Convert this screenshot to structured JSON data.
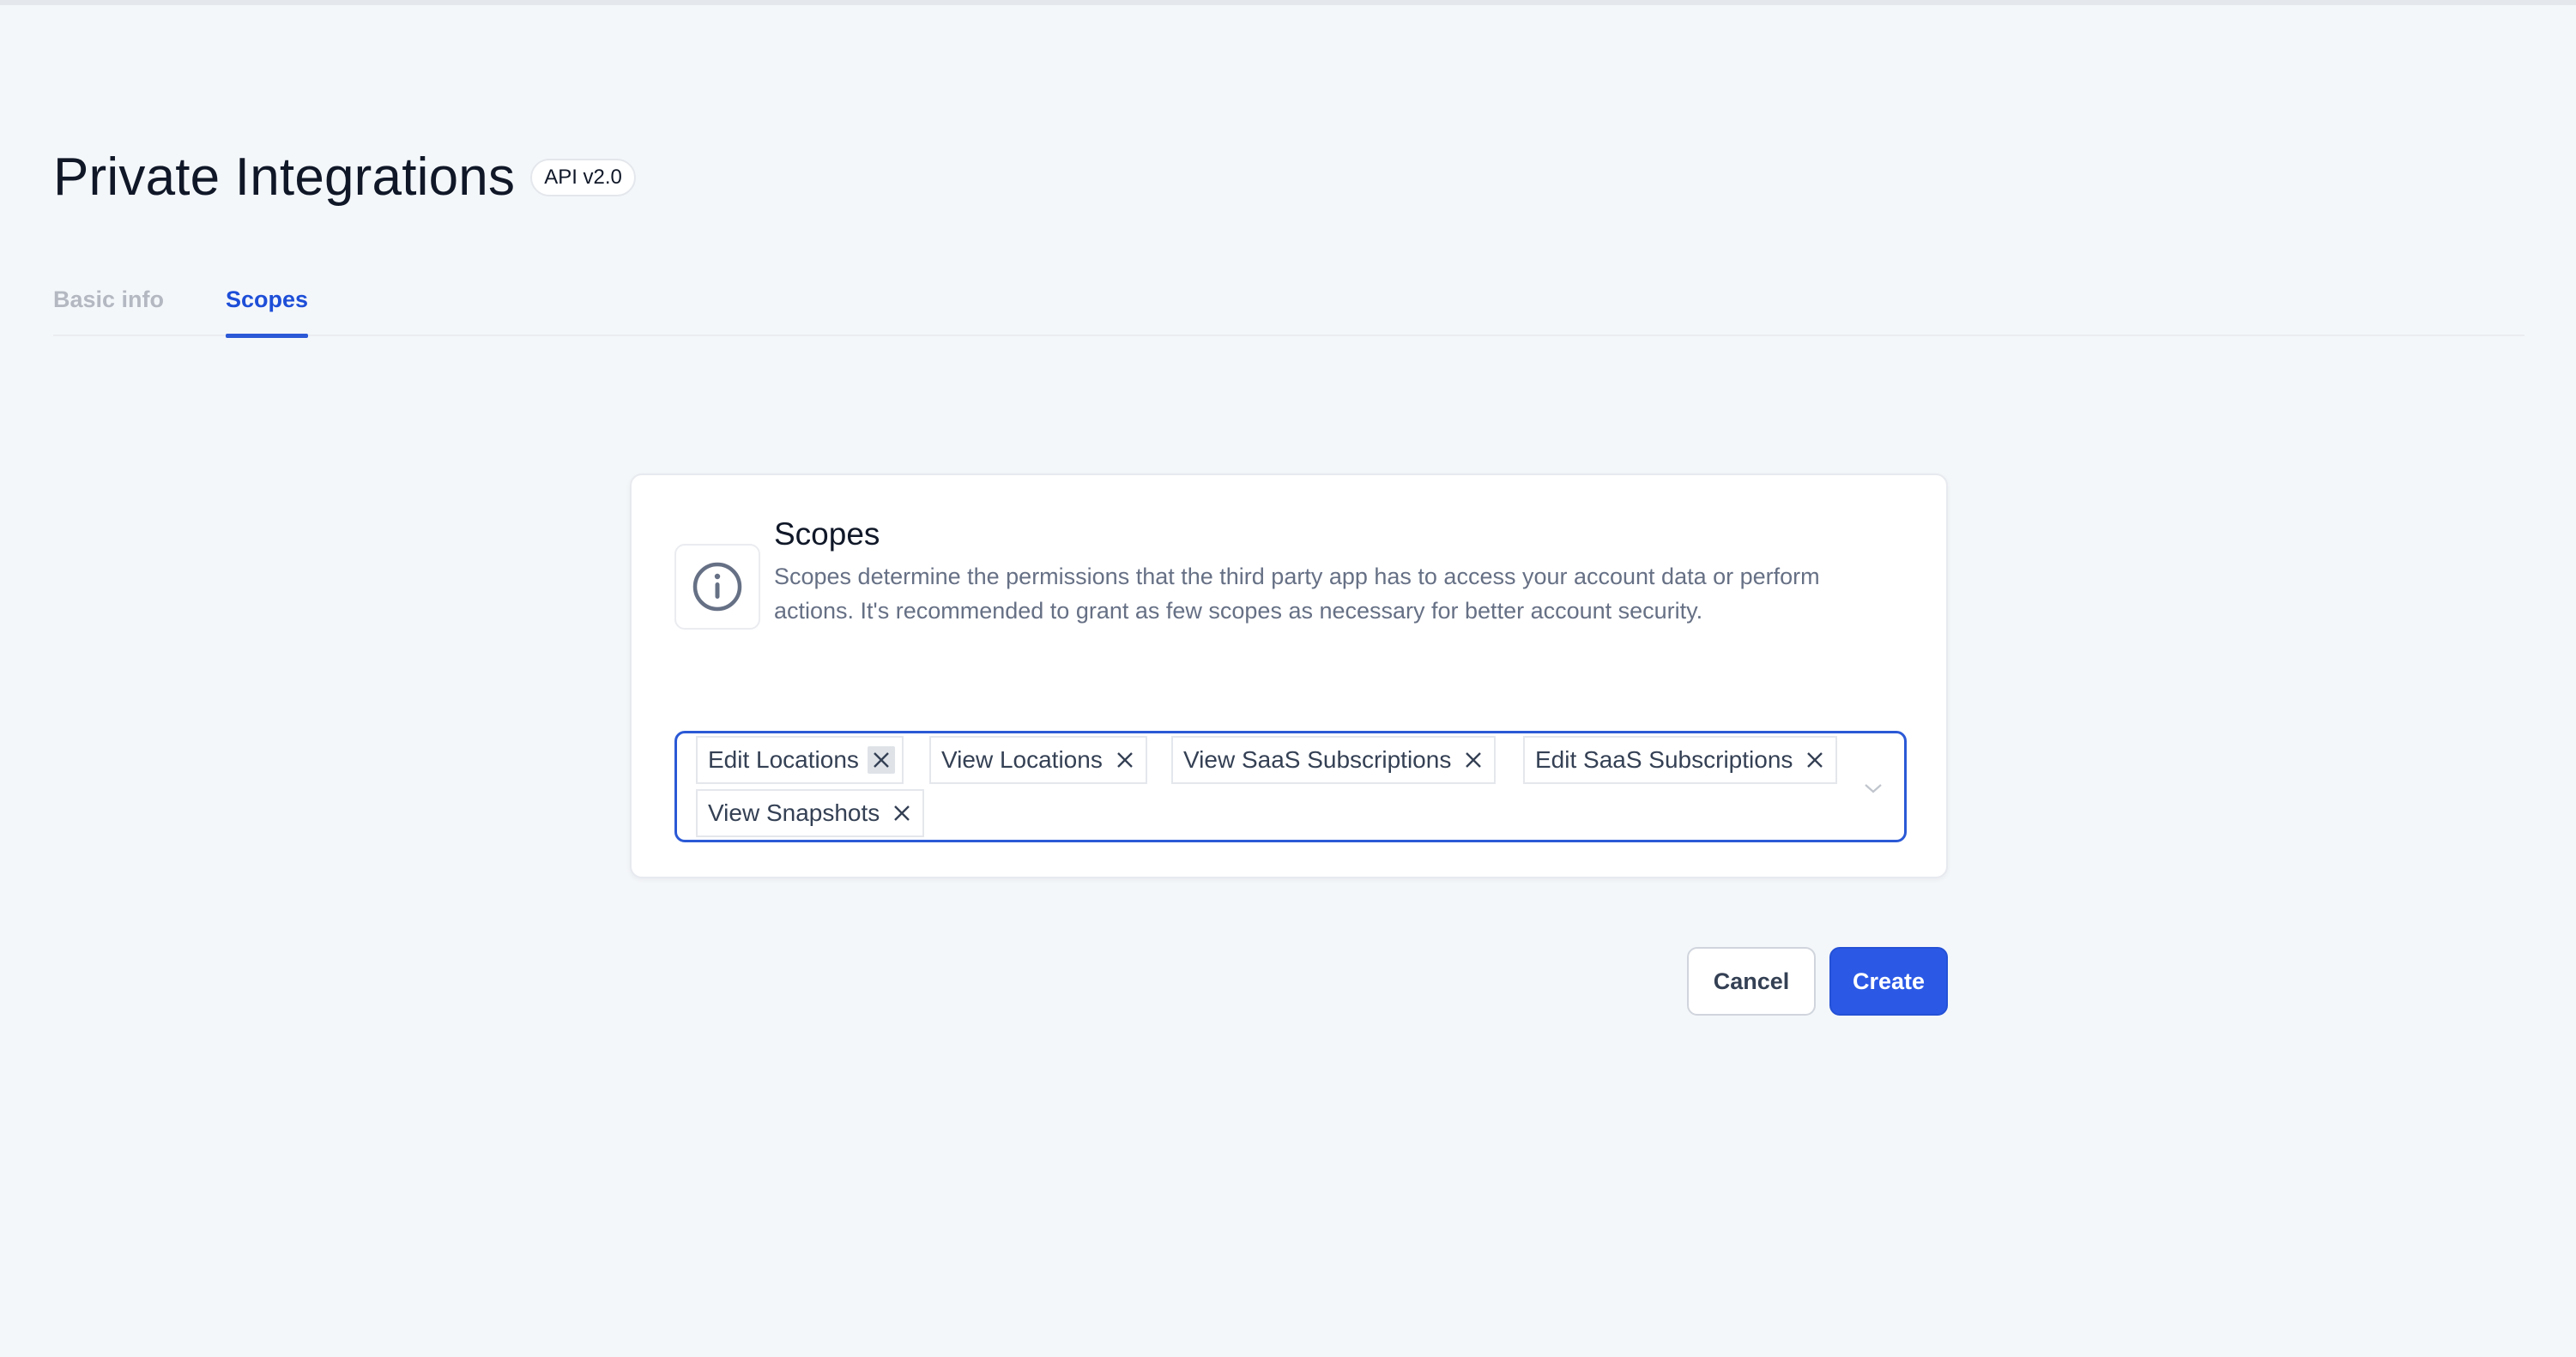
{
  "header": {
    "title": "Private Integrations",
    "badge": "API v2.0"
  },
  "tabs": [
    {
      "label": "Basic info",
      "active": false
    },
    {
      "label": "Scopes",
      "active": true
    }
  ],
  "scopes_card": {
    "icon": "info-icon",
    "title": "Scopes",
    "description": "Scopes determine the permissions that the third party app has to access your account data or perform actions. It's recommended to grant as few scopes as necessary for better account security.",
    "selected_scopes": [
      "Edit Locations",
      "View Locations",
      "View SaaS Subscriptions",
      "Edit SaaS Subscriptions",
      "View Snapshots"
    ]
  },
  "actions": {
    "cancel_label": "Cancel",
    "create_label": "Create"
  },
  "colors": {
    "accent": "#2b59e6",
    "active_tab": "#1d4ed8",
    "background": "#f4f7fa"
  }
}
